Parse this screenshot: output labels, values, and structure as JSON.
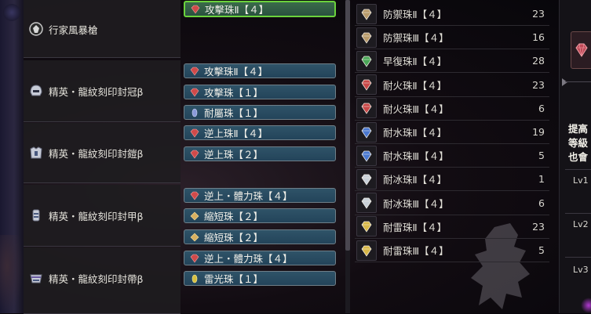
{
  "equipment": [
    {
      "name": "行家風暴槍",
      "icon": "weapon-icon",
      "slots": [
        {
          "label": "攻擊珠Ⅱ【４】",
          "gem": "#d04a4a",
          "selected": true
        }
      ]
    },
    {
      "name": "精英・龍紋刻印封冠β",
      "icon": "helm-icon",
      "slots": [
        {
          "label": "攻擊珠Ⅱ【４】",
          "gem": "#d04a4a"
        },
        {
          "label": "攻擊珠【１】",
          "gem": "#d04a4a"
        },
        {
          "label": "耐屬珠【１】",
          "gem": "#8a9ad8"
        }
      ]
    },
    {
      "name": "精英・龍紋刻印封鎧β",
      "icon": "chest-icon",
      "slots": [
        {
          "label": "逆上珠Ⅱ【４】",
          "gem": "#d04a4a"
        },
        {
          "label": "逆上珠【２】",
          "gem": "#d04a4a"
        }
      ]
    },
    {
      "name": "精英・龍紋刻印封甲β",
      "icon": "arm-icon",
      "slots": [
        {
          "label": "逆上・體力珠【４】",
          "gem": "#d04a4a"
        },
        {
          "label": "縮短珠【２】",
          "gem": "#d8b060"
        },
        {
          "label": "縮短珠【２】",
          "gem": "#d8b060"
        }
      ]
    },
    {
      "name": "精英・龍紋刻印封帶β",
      "icon": "waist-icon",
      "slots": [
        {
          "label": "逆上・體力珠【４】",
          "gem": "#d04a4a"
        },
        {
          "label": "雷光珠【１】",
          "gem": "#d8c040"
        }
      ]
    }
  ],
  "jewels": [
    {
      "name": "防禦珠Ⅱ【４】",
      "count": "23",
      "color": "#b89a6a"
    },
    {
      "name": "防禦珠Ⅲ【４】",
      "count": "16",
      "color": "#b89a6a"
    },
    {
      "name": "早復珠Ⅱ【４】",
      "count": "28",
      "color": "#4aa858"
    },
    {
      "name": "耐火珠Ⅱ【４】",
      "count": "23",
      "color": "#c84848"
    },
    {
      "name": "耐火珠Ⅲ【４】",
      "count": "6",
      "color": "#c84848"
    },
    {
      "name": "耐水珠Ⅱ【４】",
      "count": "19",
      "color": "#4a78d0"
    },
    {
      "name": "耐水珠Ⅲ【４】",
      "count": "5",
      "color": "#4a78d0"
    },
    {
      "name": "耐冰珠Ⅱ【４】",
      "count": "1",
      "color": "#c8d0d8"
    },
    {
      "name": "耐冰珠Ⅲ【４】",
      "count": "6",
      "color": "#c8d0d8"
    },
    {
      "name": "耐雷珠Ⅱ【４】",
      "count": "23",
      "color": "#d8b848"
    },
    {
      "name": "耐雷珠Ⅲ【４】",
      "count": "5",
      "color": "#d8b848"
    }
  ],
  "right_panel": {
    "desc_lines": [
      "提高",
      "等級",
      "也會"
    ],
    "levels": [
      "Lv1",
      "Lv2",
      "Lv3"
    ],
    "icon": "gem-icon"
  }
}
